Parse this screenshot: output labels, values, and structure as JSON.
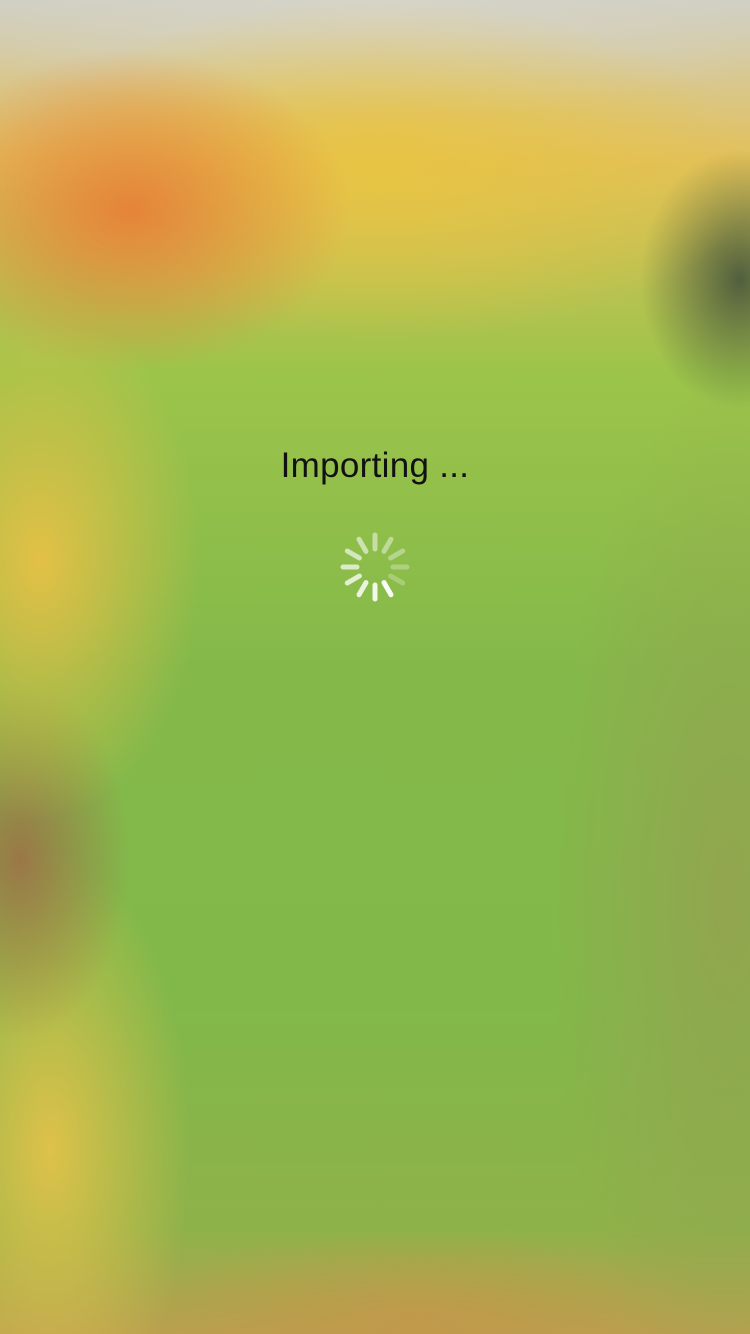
{
  "screen": {
    "status_text": "Importing ...",
    "spinner_icon": "activity-spinner-icon",
    "colors": {
      "background_green": "#86bb48",
      "text": "#111111",
      "spinner": "#ffffff"
    }
  }
}
